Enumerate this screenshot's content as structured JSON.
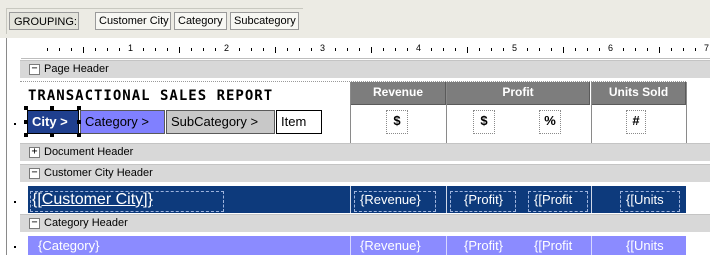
{
  "grouping": {
    "label": "GROUPING:",
    "chips": [
      "Customer City",
      "Category",
      "Subcategory"
    ]
  },
  "ruler": {
    "numbers": [
      "1",
      "2",
      "3",
      "4",
      "5",
      "6",
      "7"
    ]
  },
  "bands": {
    "page_header": "Page Header",
    "document_header": "Document Header",
    "customer_city_header": "Customer City Header",
    "category_header": "Category Header"
  },
  "toggles": {
    "expanded": "−",
    "collapsed": "+"
  },
  "report": {
    "title": "TRANSACTIONAL SALES REPORT",
    "columns": [
      "Revenue",
      "Profit",
      "Units Sold"
    ],
    "symbols": {
      "revenue": "$",
      "profit": "$",
      "profit_pct": "%",
      "units": "#"
    },
    "breadcrumb": {
      "city": "City >",
      "category": "Category >",
      "subcategory": "SubCategory >",
      "item": "Item"
    }
  },
  "customer_city_row": {
    "name": "{[Customer City]}",
    "revenue": "{Revenue}",
    "profit": "{Profit}",
    "profit_pct": "{[Profit",
    "units": "{[Units"
  },
  "category_row": {
    "name": "{Category}",
    "revenue": "{Revenue}",
    "profit": "{Profit}",
    "profit_pct": "{[Profit",
    "units": "{[Units"
  },
  "colors": {
    "city_band": "#0d3a7c",
    "category_band": "#8b8bff",
    "column_header": "#7d7d7d",
    "band_header": "#d8d8d8"
  }
}
